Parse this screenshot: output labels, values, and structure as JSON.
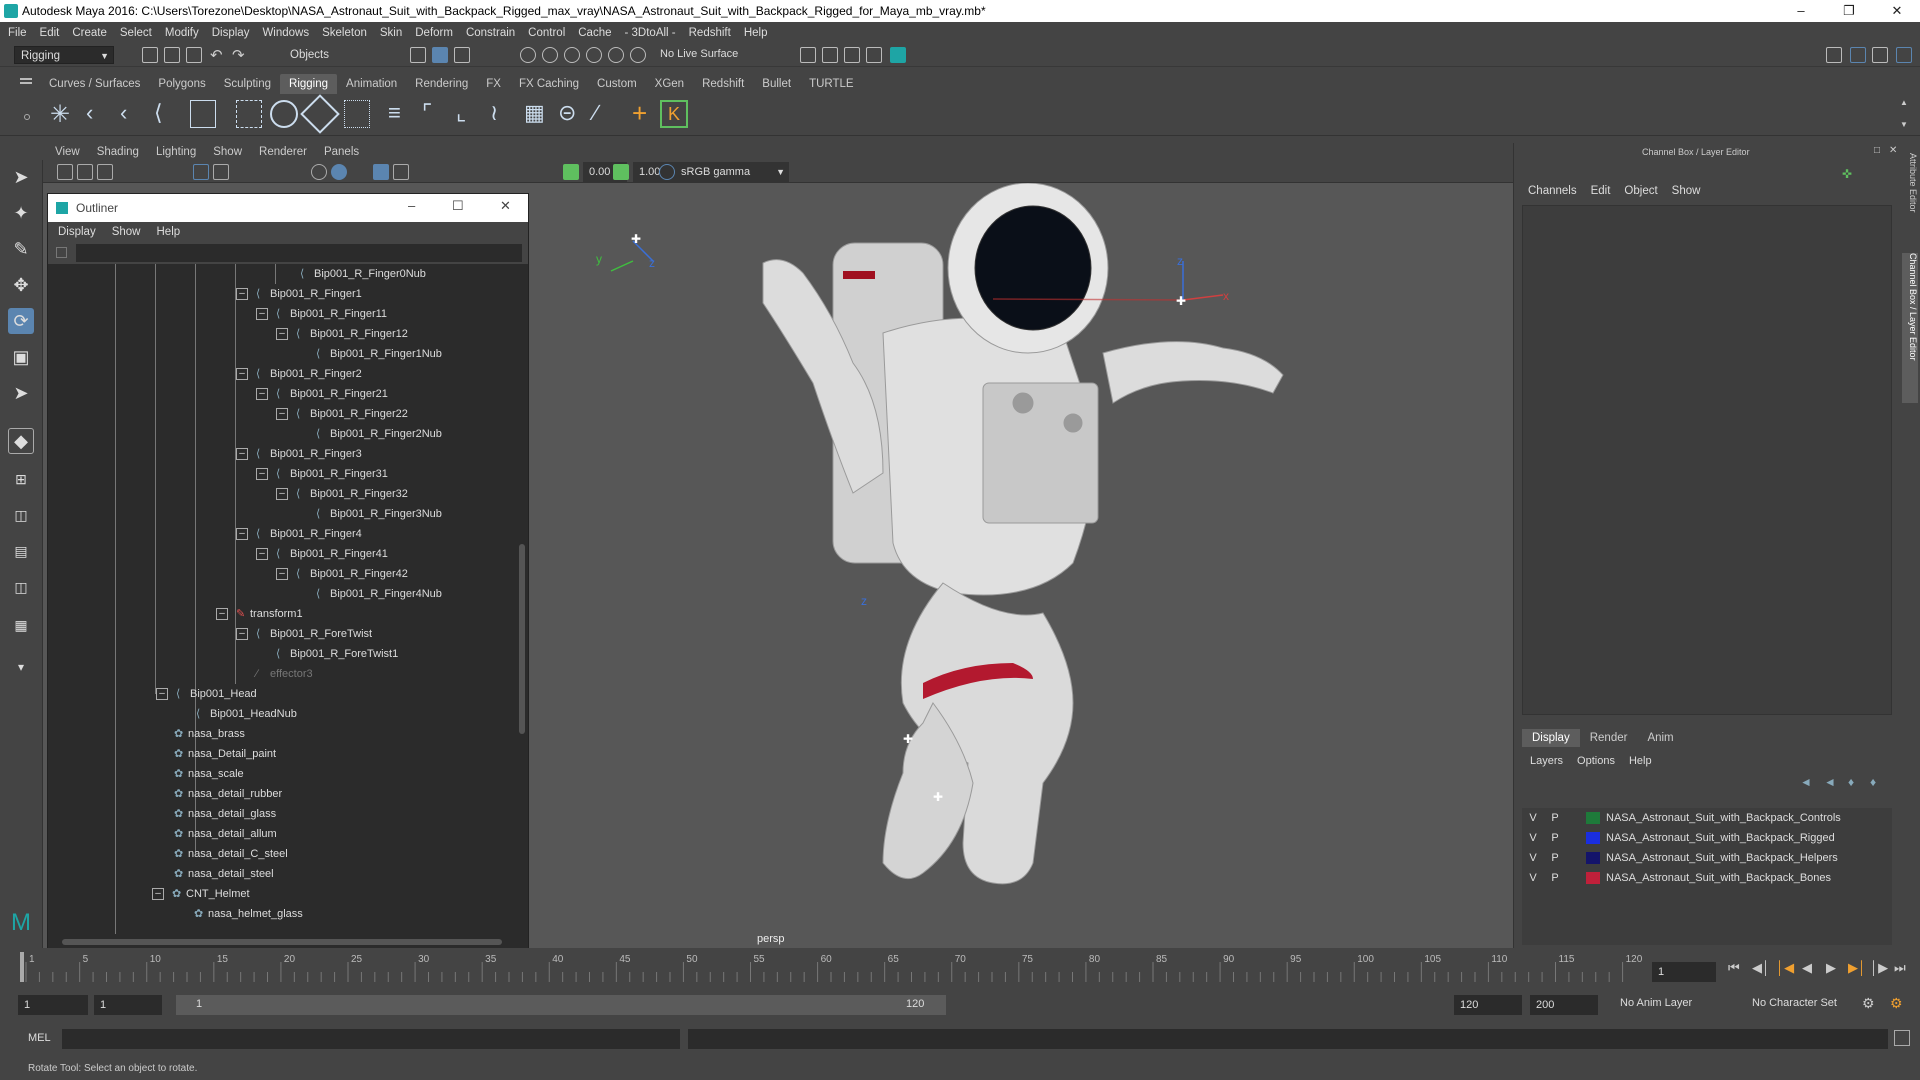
{
  "window": {
    "title": "Autodesk Maya 2016: C:\\Users\\Torezone\\Desktop\\NASA_Astronaut_Suit_with_Backpack_Rigged_max_vray\\NASA_Astronaut_Suit_with_Backpack_Rigged_for_Maya_mb_vray.mb*"
  },
  "menubar": [
    "File",
    "Edit",
    "Create",
    "Select",
    "Modify",
    "Display",
    "Windows",
    "Skeleton",
    "Skin",
    "Deform",
    "Constrain",
    "Control",
    "Cache",
    "- 3DtoAll -",
    "Redshift",
    "Help"
  ],
  "statusline": {
    "menuset": "Rigging",
    "selection_mode": "Objects",
    "live_surface": "No Live Surface"
  },
  "shelf_tabs": [
    "Curves / Surfaces",
    "Polygons",
    "Sculpting",
    "Rigging",
    "Animation",
    "Rendering",
    "FX",
    "FX Caching",
    "Custom",
    "XGen",
    "Redshift",
    "Bullet",
    "TURTLE"
  ],
  "active_shelf": "Rigging",
  "viewport": {
    "menu": [
      "View",
      "Shading",
      "Lighting",
      "Show",
      "Renderer",
      "Panels"
    ],
    "near_value": "0.00",
    "far_value": "1.00",
    "color_space": "sRGB gamma",
    "camera_label": "persp"
  },
  "outliner": {
    "title": "Outliner",
    "menu": [
      "Display",
      "Show",
      "Help"
    ],
    "rows": [
      {
        "label": "Bip001_R_Finger0Nub",
        "type": "joint"
      },
      {
        "label": "Bip001_R_Finger1",
        "type": "joint"
      },
      {
        "label": "Bip001_R_Finger11",
        "type": "joint"
      },
      {
        "label": "Bip001_R_Finger12",
        "type": "joint"
      },
      {
        "label": "Bip001_R_Finger1Nub",
        "type": "joint"
      },
      {
        "label": "Bip001_R_Finger2",
        "type": "joint"
      },
      {
        "label": "Bip001_R_Finger21",
        "type": "joint"
      },
      {
        "label": "Bip001_R_Finger22",
        "type": "joint"
      },
      {
        "label": "Bip001_R_Finger2Nub",
        "type": "joint"
      },
      {
        "label": "Bip001_R_Finger3",
        "type": "joint"
      },
      {
        "label": "Bip001_R_Finger31",
        "type": "joint"
      },
      {
        "label": "Bip001_R_Finger32",
        "type": "joint"
      },
      {
        "label": "Bip001_R_Finger3Nub",
        "type": "joint"
      },
      {
        "label": "Bip001_R_Finger4",
        "type": "joint"
      },
      {
        "label": "Bip001_R_Finger41",
        "type": "joint"
      },
      {
        "label": "Bip001_R_Finger42",
        "type": "joint"
      },
      {
        "label": "Bip001_R_Finger4Nub",
        "type": "joint"
      },
      {
        "label": "transform1",
        "type": "transform"
      },
      {
        "label": "Bip001_R_ForeTwist",
        "type": "joint"
      },
      {
        "label": "Bip001_R_ForeTwist1",
        "type": "joint"
      },
      {
        "label": "effector3",
        "type": "effector"
      },
      {
        "label": "Bip001_Head",
        "type": "joint"
      },
      {
        "label": "Bip001_HeadNub",
        "type": "joint"
      },
      {
        "label": "nasa_brass",
        "type": "mesh"
      },
      {
        "label": "nasa_Detail_paint",
        "type": "mesh"
      },
      {
        "label": "nasa_scale",
        "type": "mesh"
      },
      {
        "label": "nasa_detail_rubber",
        "type": "mesh"
      },
      {
        "label": "nasa_detail_glass",
        "type": "mesh"
      },
      {
        "label": "nasa_detail_allum",
        "type": "mesh"
      },
      {
        "label": "nasa_detail_C_steel",
        "type": "mesh"
      },
      {
        "label": "nasa_detail_steel",
        "type": "mesh"
      },
      {
        "label": "CNT_Helmet",
        "type": "mesh"
      },
      {
        "label": "nasa_helmet_glass",
        "type": "mesh"
      }
    ]
  },
  "channel_box": {
    "title": "Channel Box / Layer Editor",
    "menu": [
      "Channels",
      "Edit",
      "Object",
      "Show"
    ],
    "layer_tabs": [
      "Display",
      "Render",
      "Anim"
    ],
    "layer_menu": [
      "Layers",
      "Options",
      "Help"
    ],
    "layers": [
      {
        "v": "V",
        "p": "P",
        "color": "#1e7a3a",
        "name": "NASA_Astronaut_Suit_with_Backpack_Controls"
      },
      {
        "v": "V",
        "p": "P",
        "color": "#1a2ee0",
        "name": "NASA_Astronaut_Suit_with_Backpack_Rigged"
      },
      {
        "v": "V",
        "p": "P",
        "color": "#14146a",
        "name": "NASA_Astronaut_Suit_with_Backpack_Helpers"
      },
      {
        "v": "V",
        "p": "P",
        "color": "#c0203a",
        "name": "NASA_Astronaut_Suit_with_Backpack_Bones"
      }
    ],
    "side_tabs": [
      "Attribute Editor",
      "Channel Box / Layer Editor"
    ]
  },
  "timeline": {
    "ticks": [
      "1",
      "5",
      "10",
      "15",
      "20",
      "25",
      "30",
      "35",
      "40",
      "45",
      "50",
      "55",
      "60",
      "65",
      "70",
      "75",
      "80",
      "85",
      "90",
      "95",
      "100",
      "105",
      "110",
      "115",
      "120"
    ],
    "current_frame": "1"
  },
  "range": {
    "start": "1",
    "playback_start": "1",
    "slider_start": "1",
    "slider_end": "120",
    "playback_end": "120",
    "end": "200",
    "anim_layer": "No Anim Layer",
    "character_set": "No Character Set"
  },
  "cmdline": {
    "label": "MEL"
  },
  "helpline": "Rotate Tool: Select an object to rotate."
}
